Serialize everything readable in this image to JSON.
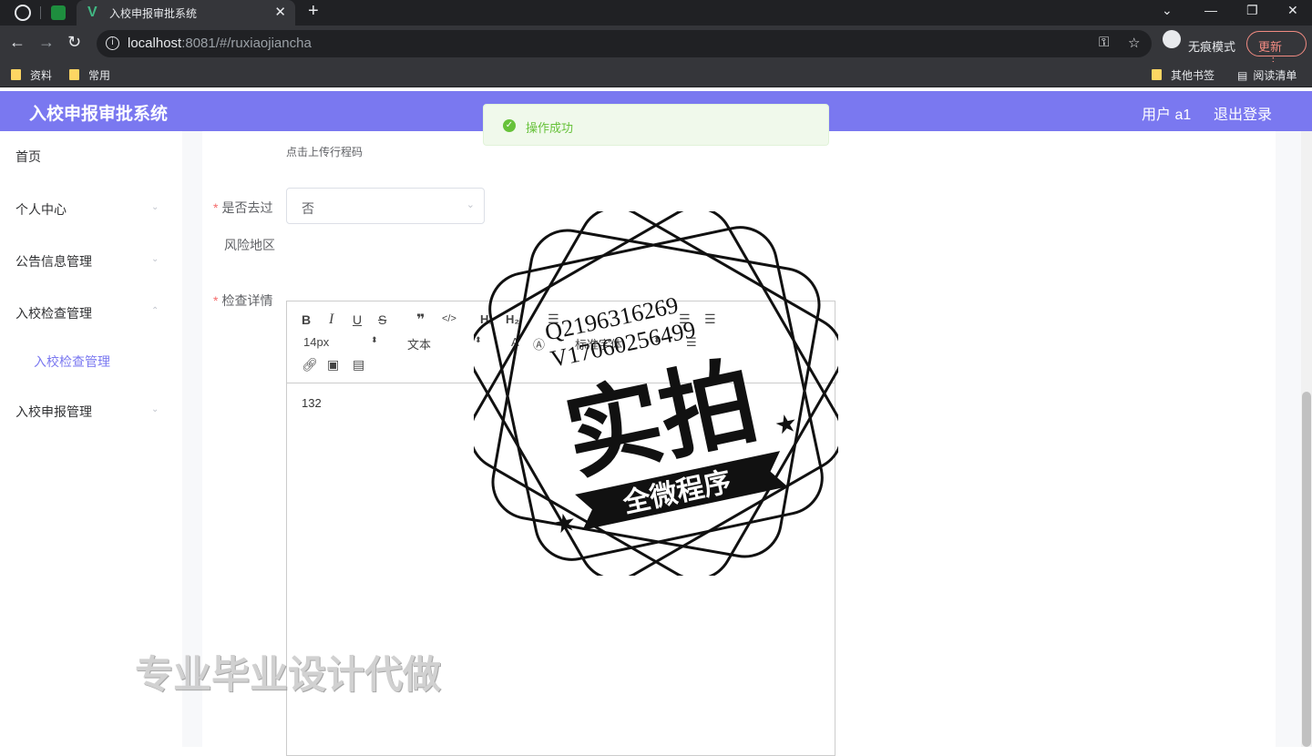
{
  "browser": {
    "tab_title": "入校申报审批系统",
    "url_host": "localhost",
    "url_rest": ":8081/#/ruxiaojiancha",
    "incognito_label": "无痕模式",
    "update_label": "更新",
    "bookmarks": [
      "资料",
      "常用"
    ],
    "bookmarks_right": [
      "其他书签",
      "阅读清单"
    ]
  },
  "app": {
    "title": "入校申报审批系统",
    "user_label": "用户 a1",
    "logout_label": "退出登录"
  },
  "sidebar": {
    "items": [
      {
        "label": "首页"
      },
      {
        "label": "个人中心"
      },
      {
        "label": "公告信息管理"
      },
      {
        "label": "入校检查管理"
      },
      {
        "label": "入校检查管理"
      },
      {
        "label": "入校申报管理"
      }
    ]
  },
  "form": {
    "upload_hint": "点击上传行程码",
    "risk_label_1": "是否去过",
    "risk_label_2": "风险地区",
    "risk_value": "否",
    "detail_label": "检查详情"
  },
  "editor": {
    "font_size": "14px",
    "block_type": "文本",
    "font_family": "标准字体",
    "content": "132"
  },
  "toast": {
    "message": "操作成功",
    "color": "#67c23a"
  },
  "watermark": {
    "line1": "Q2196316269",
    "line2": "V17060256499",
    "big": "实拍",
    "ribbon": "全微程序",
    "footer": "专业毕业设计代做"
  },
  "colors": {
    "header": "#7a78f0",
    "active_menu": "#7a78f0",
    "required": "#f56c6c"
  }
}
